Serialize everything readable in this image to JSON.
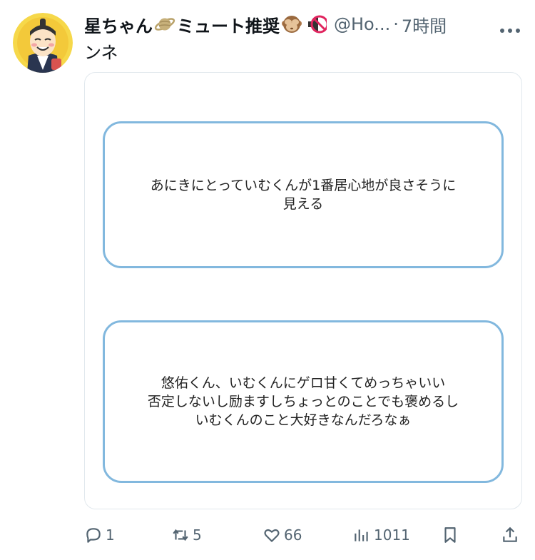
{
  "tweet": {
    "display_name": "星ちゃん",
    "display_name_suffix": "ミュート推奨",
    "emoji_icons": [
      "ringed-planet-icon",
      "see-no-evil-monkey-icon",
      "muted-speaker-icon"
    ],
    "handle": "@Ho...",
    "separator": "·",
    "time": "7時間",
    "text": "ンネ"
  },
  "media": {
    "bubbles": [
      {
        "lines": [
          "あにきにとっていむくんが1番居心地が良さそうに",
          "見える"
        ]
      },
      {
        "lines": [
          "悠佑くん、いむくんにゲロ甘くてめっちゃいい",
          "否定しないし励ますしちょっとのことでも褒めるし",
          "いむくんのこと大好きなんだろなぁ"
        ]
      }
    ],
    "border_color": "#82b8de"
  },
  "actions": {
    "reply_count": "1",
    "retweet_count": "5",
    "like_count": "66",
    "view_count": "1011"
  },
  "colors": {
    "text": "#0f1419",
    "secondary": "#536471"
  }
}
